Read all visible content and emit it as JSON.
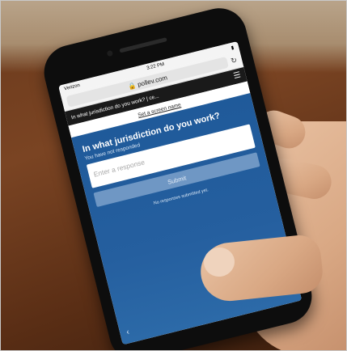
{
  "status_bar": {
    "carrier": "Verizon",
    "time": "3:22 PM"
  },
  "browser": {
    "url": "pollev.com",
    "reload_icon": "reload-icon"
  },
  "poll_header": {
    "title": "In what jurisdiction do you work? | ce...",
    "menu_icon": "hamburger-menu-icon"
  },
  "screen_name_link": "Set a screen name",
  "poll": {
    "question": "In what jurisdiction do you work?",
    "status": "You have not responded",
    "response_placeholder": "Enter a response",
    "submit_label": "Submit",
    "no_responses": "No responses submitted yet.",
    "back_icon": "chevron-left-icon"
  }
}
